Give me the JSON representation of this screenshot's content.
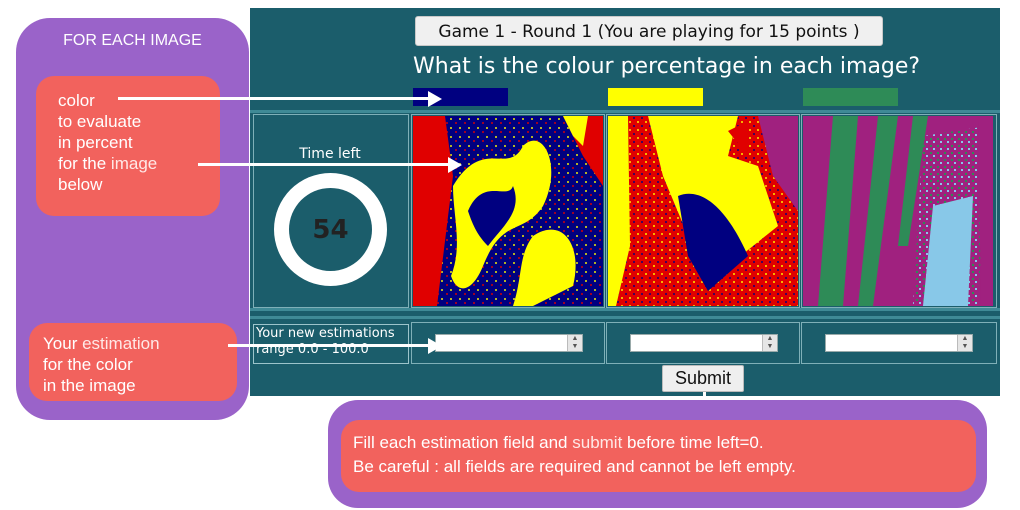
{
  "left_panel": {
    "title": "FOR EACH IMAGE",
    "color_callout": {
      "line1": "color",
      "line2": "to evaluate",
      "line3": "in percent",
      "line4_prefix": "for the ",
      "line4_highlight": "image",
      "line5": "below"
    },
    "estimation_callout": {
      "line1_prefix": "Your ",
      "line1_highlight": "estimation",
      "line2": "for the color",
      "line3": "in the image"
    }
  },
  "game": {
    "round_label": "Game 1 - Round 1 (You are playing for 15 points )",
    "question": "What is the colour percentage in each image?",
    "swatches": [
      "#000080",
      "#ffff00",
      "#2e8b57"
    ],
    "timer": {
      "label": "Time left",
      "value": "54"
    },
    "estimation_label": "Your new estimations range 0.0 - 100.0",
    "inputs": [
      {
        "value": ""
      },
      {
        "value": ""
      },
      {
        "value": ""
      }
    ],
    "submit_label": "Submit"
  },
  "bottom_panel": {
    "line1_prefix": "Fill each estimation field and ",
    "line1_highlight": "submit",
    "line1_suffix": " before time left=0.",
    "line2": "Be careful : all fields are required and cannot be left empty."
  }
}
